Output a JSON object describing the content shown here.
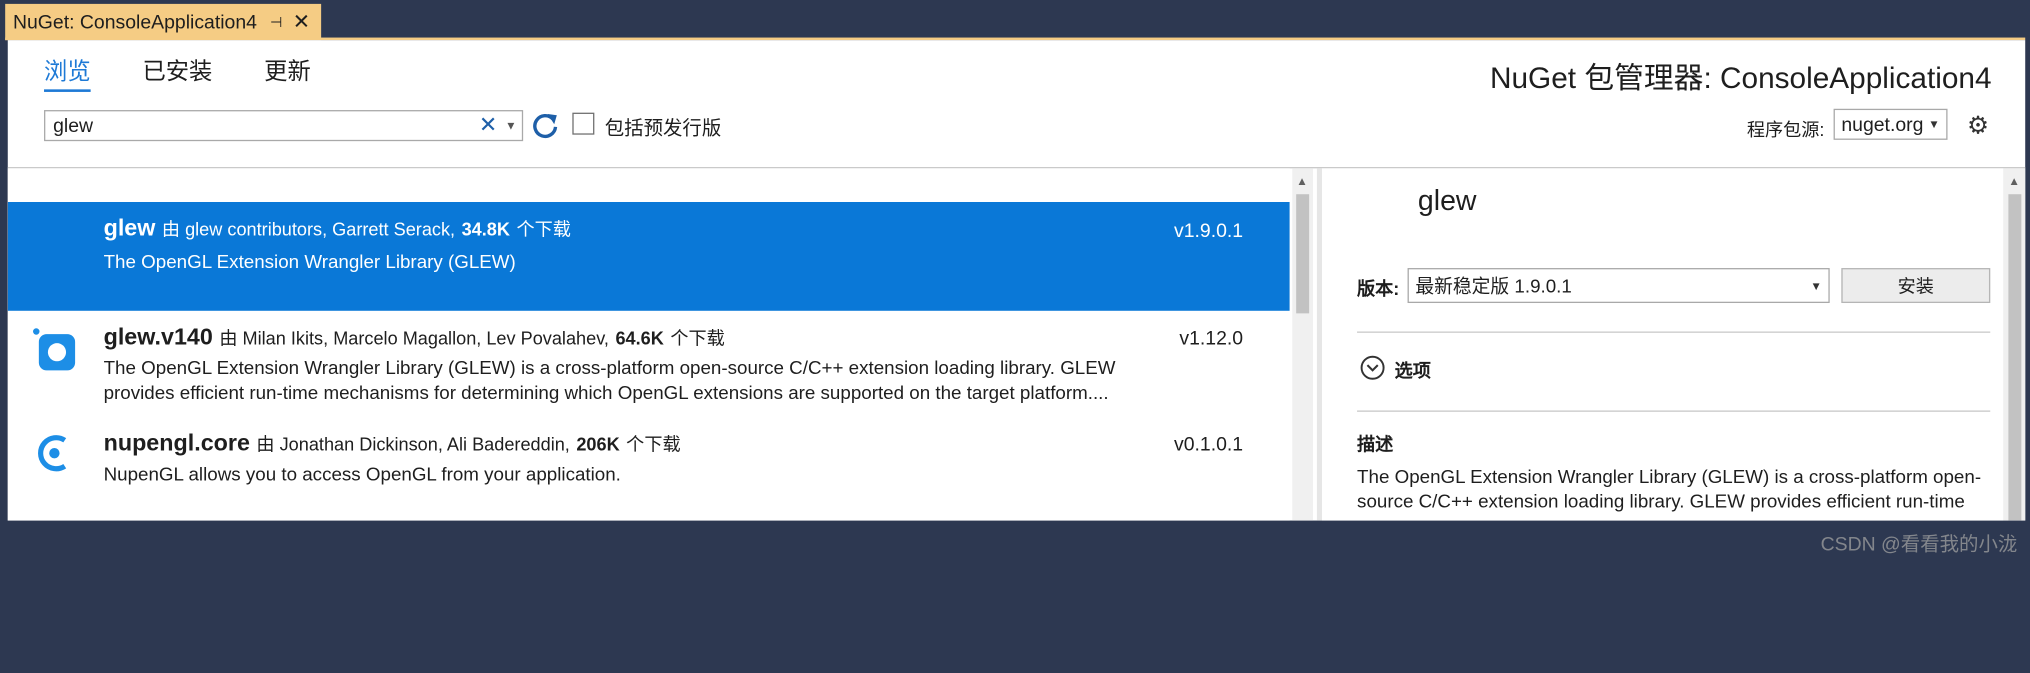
{
  "tab": {
    "title": "NuGet: ConsoleApplication4",
    "pin_icon": "pin-icon",
    "close_icon": "close-icon"
  },
  "nav": {
    "browse": "浏览",
    "installed": "已安装",
    "updates": "更新"
  },
  "manager_title": "NuGet 包管理器: ConsoleApplication4",
  "search": {
    "value": "glew",
    "clear_icon": "clear-icon"
  },
  "prerelease_label": "包括预发行版",
  "package_source": {
    "label": "程序包源:",
    "value": "nuget.org"
  },
  "packages": [
    {
      "name": "glew",
      "by": "由 glew contributors,  Garrett Serack,",
      "downloads": "34.8K",
      "downloads_suffix": "个下载",
      "description": "The OpenGL Extension Wrangler Library (GLEW)",
      "version": "v1.9.0.1"
    },
    {
      "name": "glew.v140",
      "by": "由 Milan Ikits,  Marcelo Magallon,  Lev Povalahev,",
      "downloads": "64.6K",
      "downloads_suffix": "个下载",
      "description": "The OpenGL Extension Wrangler Library (GLEW) is a cross-platform open-source C/C++ extension loading library. GLEW provides efficient run-time mechanisms for determining which OpenGL extensions are supported on the target platform....",
      "version": "v1.12.0"
    },
    {
      "name": "nupengl.core",
      "by": "由 Jonathan Dickinson,  Ali Badereddin,",
      "downloads": "206K",
      "downloads_suffix": "个下载",
      "description": "NupenGL allows you to access OpenGL from your application.",
      "version": "v0.1.0.1"
    }
  ],
  "details": {
    "name": "glew",
    "version_label": "版本:",
    "version_value": "最新稳定版 1.9.0.1",
    "install": "安装",
    "options": "选项",
    "description_label": "描述",
    "description": "The OpenGL Extension Wrangler Library (GLEW) is a cross-platform open-source C/C++ extension loading library. GLEW provides efficient run-time"
  },
  "watermark": "CSDN @看看我的小泷",
  "colors": {
    "selected": "#0a78d7",
    "tab": "#f5cc84",
    "accent": "#1e7ad6"
  }
}
